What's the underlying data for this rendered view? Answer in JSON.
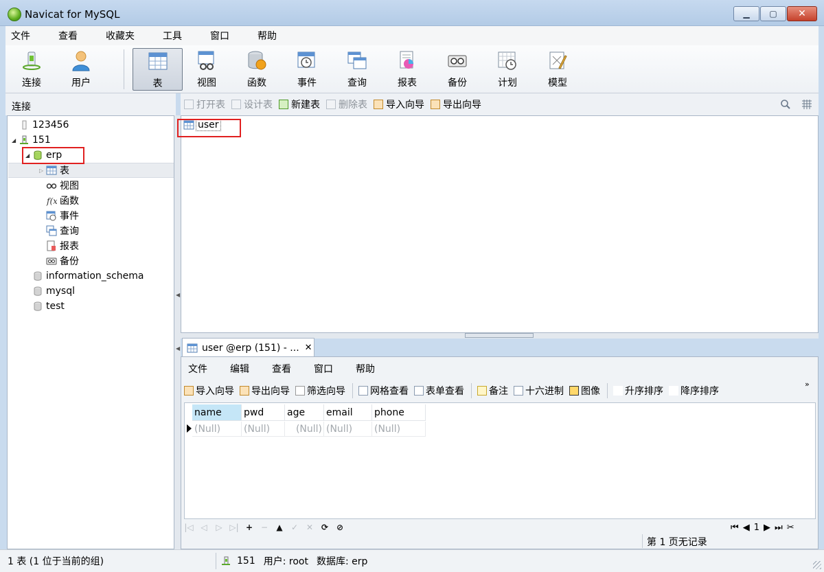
{
  "window": {
    "title": "Navicat for MySQL",
    "minimize": "▁",
    "maximize": "▢",
    "close": "✕"
  },
  "menu": [
    "文件",
    "查看",
    "收藏夹",
    "工具",
    "窗口",
    "帮助"
  ],
  "toolbar": [
    {
      "label": "连接",
      "icon": "connection-icon"
    },
    {
      "label": "用户",
      "icon": "user-icon"
    },
    {
      "label": "表",
      "icon": "table-icon"
    },
    {
      "label": "视图",
      "icon": "view-icon"
    },
    {
      "label": "函数",
      "icon": "function-icon"
    },
    {
      "label": "事件",
      "icon": "event-icon"
    },
    {
      "label": "查询",
      "icon": "query-icon"
    },
    {
      "label": "报表",
      "icon": "report-icon"
    },
    {
      "label": "备份",
      "icon": "backup-icon"
    },
    {
      "label": "计划",
      "icon": "schedule-icon"
    },
    {
      "label": "模型",
      "icon": "model-icon"
    }
  ],
  "left_panel": {
    "header": "连接",
    "tree": [
      {
        "label": "123456"
      },
      {
        "label": "151",
        "toggle": "◢"
      },
      {
        "label": "erp",
        "toggle": "◢"
      },
      {
        "label": "表",
        "toggle": "▷"
      },
      {
        "label": "视图"
      },
      {
        "label": "函数"
      },
      {
        "label": "事件"
      },
      {
        "label": "查询"
      },
      {
        "label": "报表"
      },
      {
        "label": "备份"
      },
      {
        "label": "information_schema"
      },
      {
        "label": "mysql"
      },
      {
        "label": "test"
      }
    ]
  },
  "object_toolbar": [
    {
      "label": "打开表",
      "enabled": false
    },
    {
      "label": "设计表",
      "enabled": false
    },
    {
      "label": "新建表",
      "enabled": true
    },
    {
      "label": "删除表",
      "enabled": false
    },
    {
      "label": "导入向导",
      "enabled": true
    },
    {
      "label": "导出向导",
      "enabled": true
    }
  ],
  "objects": [
    {
      "label": "user"
    }
  ],
  "tab": {
    "title": "user @erp (151) - ...",
    "close": "✕"
  },
  "sub_menu": [
    "文件",
    "编辑",
    "查看",
    "窗口",
    "帮助"
  ],
  "sub_toolbar": {
    "group1": [
      "导入向导",
      "导出向导",
      "筛选向导"
    ],
    "group2": [
      "网格查看",
      "表单查看"
    ],
    "group3": [
      "备注",
      "十六进制",
      "图像"
    ],
    "group4": [
      "升序排序",
      "降序排序"
    ],
    "more": "»"
  },
  "grid": {
    "columns": [
      "name",
      "pwd",
      "age",
      "email",
      "phone"
    ],
    "rows": [
      [
        "(Null)",
        "(Null)",
        "(Null)",
        "(Null)",
        "(Null)"
      ]
    ]
  },
  "record_nav": {
    "buttons": [
      "|◁",
      "◁",
      "▷",
      "▷|",
      "+",
      "−",
      "▲",
      "✓",
      "✕",
      "⟳",
      "⊘"
    ],
    "page": "1",
    "status": "第 1 页无记录"
  },
  "statusbar": {
    "left": "1 表 (1 位于当前的组)",
    "connection": "151",
    "user": "用户: root",
    "database": "数据库: erp"
  }
}
